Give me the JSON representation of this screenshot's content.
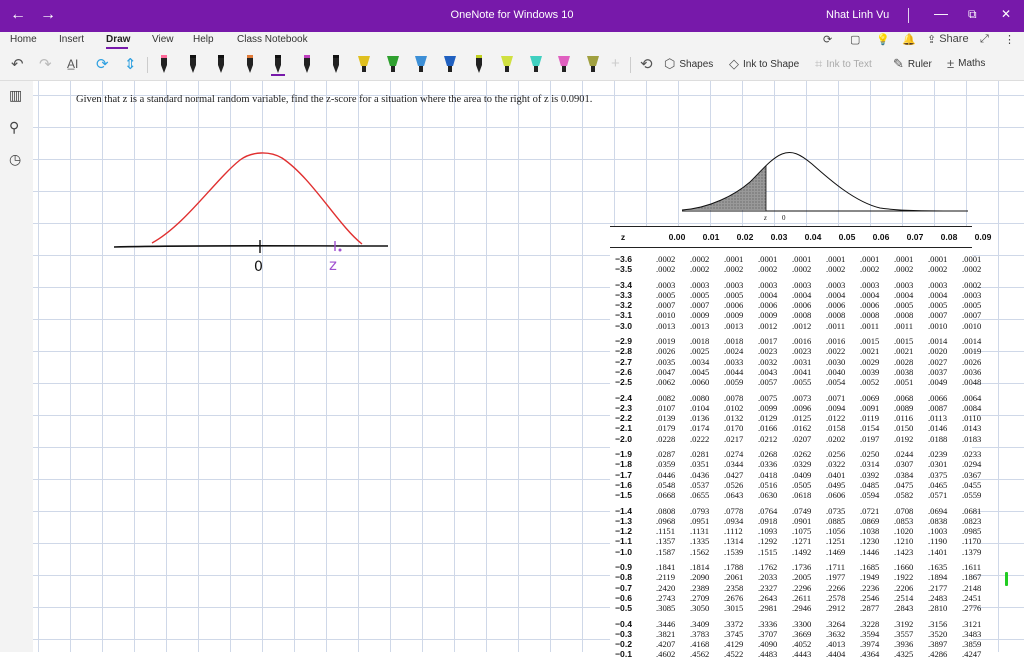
{
  "titlebar": {
    "back_icon": "arrow-left-icon",
    "forward_icon": "arrow-right-icon",
    "title": "OneNote for Windows 10",
    "user": "Nhat Linh Vu",
    "minimize": "—",
    "restore": "⧉",
    "close": "✕",
    "color": "#7719aa"
  },
  "tabs": [
    {
      "label": "Home"
    },
    {
      "label": "Insert"
    },
    {
      "label": "Draw",
      "active": true
    },
    {
      "label": "View"
    },
    {
      "label": "Help"
    },
    {
      "label": "Class Notebook"
    }
  ],
  "share_label": "Share",
  "ribbon": {
    "shapes_label": "Shapes",
    "ink_to_shape_label": "Ink to Shape",
    "ink_to_text_label": "Ink to Text",
    "ruler_label": "Ruler",
    "maths_label": "Maths",
    "pen_colors": [
      "#111111",
      "#111111",
      "#111111",
      "#e07b39",
      "#111111",
      "#c040c0",
      "#111111",
      "#e0c020",
      "#2fa02f",
      "#3d8fd6",
      "#2060c0",
      "#c0d020",
      "#d0e040",
      "#40d0c0",
      "#e060c0",
      "#a0a040"
    ]
  },
  "note": {
    "question": "Given that z is a standard normal random variable, find the z-score for a situation where the area to the right of z is 0.0901."
  },
  "ink": {
    "zero_label": "0",
    "z_label": "z"
  },
  "ztable": {
    "curve_label_z": "z",
    "curve_label_0": "0",
    "header": [
      "z",
      "0.00",
      "0.01",
      "0.02",
      "0.03",
      "0.04",
      "0.05",
      "0.06",
      "0.07",
      "0.08",
      "0.09"
    ],
    "groups": [
      [
        [
          "−3.6",
          ".0002",
          ".0002",
          ".0001",
          ".0001",
          ".0001",
          ".0001",
          ".0001",
          ".0001",
          ".0001",
          ".0001"
        ],
        [
          "−3.5",
          ".0002",
          ".0002",
          ".0002",
          ".0002",
          ".0002",
          ".0002",
          ".0002",
          ".0002",
          ".0002",
          ".0002"
        ]
      ],
      [
        [
          "−3.4",
          ".0003",
          ".0003",
          ".0003",
          ".0003",
          ".0003",
          ".0003",
          ".0003",
          ".0003",
          ".0003",
          ".0002"
        ],
        [
          "−3.3",
          ".0005",
          ".0005",
          ".0005",
          ".0004",
          ".0004",
          ".0004",
          ".0004",
          ".0004",
          ".0004",
          ".0003"
        ],
        [
          "−3.2",
          ".0007",
          ".0007",
          ".0006",
          ".0006",
          ".0006",
          ".0006",
          ".0006",
          ".0005",
          ".0005",
          ".0005"
        ],
        [
          "−3.1",
          ".0010",
          ".0009",
          ".0009",
          ".0009",
          ".0008",
          ".0008",
          ".0008",
          ".0008",
          ".0007",
          ".0007"
        ],
        [
          "−3.0",
          ".0013",
          ".0013",
          ".0013",
          ".0012",
          ".0012",
          ".0011",
          ".0011",
          ".0011",
          ".0010",
          ".0010"
        ]
      ],
      [
        [
          "−2.9",
          ".0019",
          ".0018",
          ".0018",
          ".0017",
          ".0016",
          ".0016",
          ".0015",
          ".0015",
          ".0014",
          ".0014"
        ],
        [
          "−2.8",
          ".0026",
          ".0025",
          ".0024",
          ".0023",
          ".0023",
          ".0022",
          ".0021",
          ".0021",
          ".0020",
          ".0019"
        ],
        [
          "−2.7",
          ".0035",
          ".0034",
          ".0033",
          ".0032",
          ".0031",
          ".0030",
          ".0029",
          ".0028",
          ".0027",
          ".0026"
        ],
        [
          "−2.6",
          ".0047",
          ".0045",
          ".0044",
          ".0043",
          ".0041",
          ".0040",
          ".0039",
          ".0038",
          ".0037",
          ".0036"
        ],
        [
          "−2.5",
          ".0062",
          ".0060",
          ".0059",
          ".0057",
          ".0055",
          ".0054",
          ".0052",
          ".0051",
          ".0049",
          ".0048"
        ]
      ],
      [
        [
          "−2.4",
          ".0082",
          ".0080",
          ".0078",
          ".0075",
          ".0073",
          ".0071",
          ".0069",
          ".0068",
          ".0066",
          ".0064"
        ],
        [
          "−2.3",
          ".0107",
          ".0104",
          ".0102",
          ".0099",
          ".0096",
          ".0094",
          ".0091",
          ".0089",
          ".0087",
          ".0084"
        ],
        [
          "−2.2",
          ".0139",
          ".0136",
          ".0132",
          ".0129",
          ".0125",
          ".0122",
          ".0119",
          ".0116",
          ".0113",
          ".0110"
        ],
        [
          "−2.1",
          ".0179",
          ".0174",
          ".0170",
          ".0166",
          ".0162",
          ".0158",
          ".0154",
          ".0150",
          ".0146",
          ".0143"
        ],
        [
          "−2.0",
          ".0228",
          ".0222",
          ".0217",
          ".0212",
          ".0207",
          ".0202",
          ".0197",
          ".0192",
          ".0188",
          ".0183"
        ]
      ],
      [
        [
          "−1.9",
          ".0287",
          ".0281",
          ".0274",
          ".0268",
          ".0262",
          ".0256",
          ".0250",
          ".0244",
          ".0239",
          ".0233"
        ],
        [
          "−1.8",
          ".0359",
          ".0351",
          ".0344",
          ".0336",
          ".0329",
          ".0322",
          ".0314",
          ".0307",
          ".0301",
          ".0294"
        ],
        [
          "−1.7",
          ".0446",
          ".0436",
          ".0427",
          ".0418",
          ".0409",
          ".0401",
          ".0392",
          ".0384",
          ".0375",
          ".0367"
        ],
        [
          "−1.6",
          ".0548",
          ".0537",
          ".0526",
          ".0516",
          ".0505",
          ".0495",
          ".0485",
          ".0475",
          ".0465",
          ".0455"
        ],
        [
          "−1.5",
          ".0668",
          ".0655",
          ".0643",
          ".0630",
          ".0618",
          ".0606",
          ".0594",
          ".0582",
          ".0571",
          ".0559"
        ]
      ],
      [
        [
          "−1.4",
          ".0808",
          ".0793",
          ".0778",
          ".0764",
          ".0749",
          ".0735",
          ".0721",
          ".0708",
          ".0694",
          ".0681"
        ],
        [
          "−1.3",
          ".0968",
          ".0951",
          ".0934",
          ".0918",
          ".0901",
          ".0885",
          ".0869",
          ".0853",
          ".0838",
          ".0823"
        ],
        [
          "−1.2",
          ".1151",
          ".1131",
          ".1112",
          ".1093",
          ".1075",
          ".1056",
          ".1038",
          ".1020",
          ".1003",
          ".0985"
        ],
        [
          "−1.1",
          ".1357",
          ".1335",
          ".1314",
          ".1292",
          ".1271",
          ".1251",
          ".1230",
          ".1210",
          ".1190",
          ".1170"
        ],
        [
          "−1.0",
          ".1587",
          ".1562",
          ".1539",
          ".1515",
          ".1492",
          ".1469",
          ".1446",
          ".1423",
          ".1401",
          ".1379"
        ]
      ],
      [
        [
          "−0.9",
          ".1841",
          ".1814",
          ".1788",
          ".1762",
          ".1736",
          ".1711",
          ".1685",
          ".1660",
          ".1635",
          ".1611"
        ],
        [
          "−0.8",
          ".2119",
          ".2090",
          ".2061",
          ".2033",
          ".2005",
          ".1977",
          ".1949",
          ".1922",
          ".1894",
          ".1867"
        ],
        [
          "−0.7",
          ".2420",
          ".2389",
          ".2358",
          ".2327",
          ".2296",
          ".2266",
          ".2236",
          ".2206",
          ".2177",
          ".2148"
        ],
        [
          "−0.6",
          ".2743",
          ".2709",
          ".2676",
          ".2643",
          ".2611",
          ".2578",
          ".2546",
          ".2514",
          ".2483",
          ".2451"
        ],
        [
          "−0.5",
          ".3085",
          ".3050",
          ".3015",
          ".2981",
          ".2946",
          ".2912",
          ".2877",
          ".2843",
          ".2810",
          ".2776"
        ]
      ],
      [
        [
          "−0.4",
          ".3446",
          ".3409",
          ".3372",
          ".3336",
          ".3300",
          ".3264",
          ".3228",
          ".3192",
          ".3156",
          ".3121"
        ],
        [
          "−0.3",
          ".3821",
          ".3783",
          ".3745",
          ".3707",
          ".3669",
          ".3632",
          ".3594",
          ".3557",
          ".3520",
          ".3483"
        ],
        [
          "−0.2",
          ".4207",
          ".4168",
          ".4129",
          ".4090",
          ".4052",
          ".4013",
          ".3974",
          ".3936",
          ".3897",
          ".3859"
        ],
        [
          "−0.1",
          ".4602",
          ".4562",
          ".4522",
          ".4483",
          ".4443",
          ".4404",
          ".4364",
          ".4325",
          ".4286",
          ".4247"
        ]
      ]
    ]
  }
}
